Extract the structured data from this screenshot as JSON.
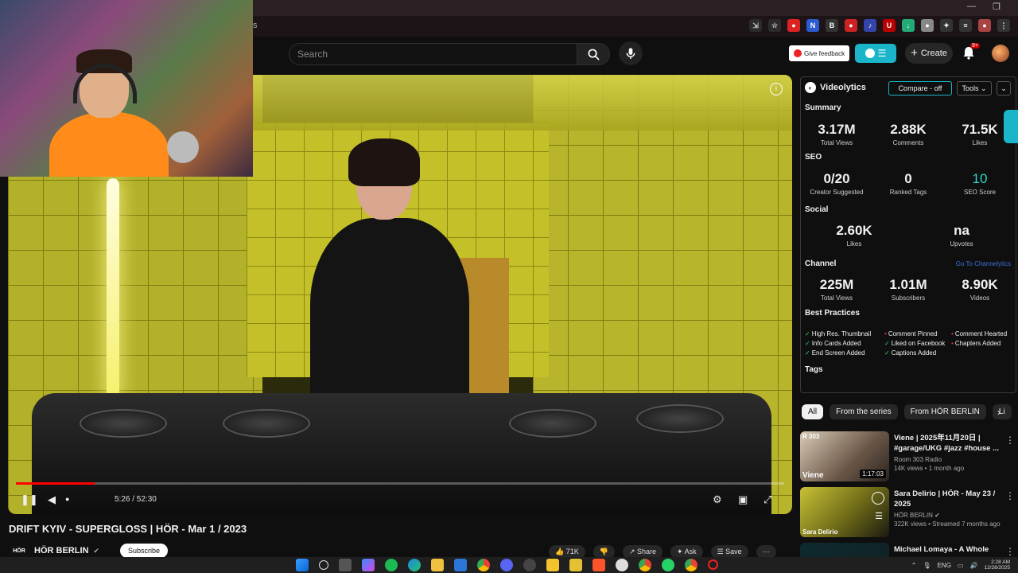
{
  "browser": {
    "url_fragment": "s"
  },
  "header": {
    "search_placeholder": "Search",
    "feedback_label": "Give feedback",
    "create_label": "Create",
    "notifications_badge": "9+"
  },
  "player": {
    "time_display": "5:26 / 52:30",
    "progress_fraction": 0.103
  },
  "video": {
    "title": "DRIFT KYIV - SUPERGLOSS | HÖR - Mar 1 / 2023",
    "channel_name": "HÖR BERLIN",
    "channel_logo_text": "HÖR",
    "subscribe_label": "Subscribe",
    "actions": {
      "likes": "71K",
      "share": "Share",
      "ask": "Ask",
      "save": "Save"
    }
  },
  "videolytics": {
    "brand": "Videolytics",
    "compare_label": "Compare - off",
    "tools_label": "Tools",
    "summary": {
      "heading": "Summary",
      "total_views": {
        "value": "3.17M",
        "label": "Total Views"
      },
      "comments": {
        "value": "2.88K",
        "label": "Comments"
      },
      "likes": {
        "value": "71.5K",
        "label": "Likes"
      }
    },
    "seo": {
      "heading": "SEO",
      "creator_suggested": {
        "value": "0/20",
        "label": "Creator Suggested"
      },
      "ranked_tags": {
        "value": "0",
        "label": "Ranked Tags"
      },
      "seo_score": {
        "value": "10",
        "label": "SEO Score"
      }
    },
    "social": {
      "heading": "Social",
      "likes": {
        "value": "2.60K",
        "label": "Likes"
      },
      "upvotes": {
        "value": "na",
        "label": "Upvotes"
      }
    },
    "channel": {
      "heading": "Channel",
      "goto_link": "Go To Channelytics",
      "total_views": {
        "value": "225M",
        "label": "Total Views"
      },
      "subscribers": {
        "value": "1.01M",
        "label": "Subscribers"
      },
      "videos": {
        "value": "8.90K",
        "label": "Videos"
      }
    },
    "best_practices": {
      "heading": "Best Practices",
      "items": [
        {
          "label": "High Res. Thumbnail",
          "ok": true
        },
        {
          "label": "Comment Pinned",
          "ok": false
        },
        {
          "label": "Comment Hearted",
          "ok": false
        },
        {
          "label": "Info Cards Added",
          "ok": true
        },
        {
          "label": "Liked on Facebook",
          "ok": true
        },
        {
          "label": "Chapters Added",
          "ok": false
        },
        {
          "label": "End Screen Added",
          "ok": true
        },
        {
          "label": "Captions Added",
          "ok": true
        }
      ]
    },
    "tags_heading": "Tags"
  },
  "chips": [
    "All",
    "From the series",
    "From HÖR BERLIN",
    "Li"
  ],
  "related": [
    {
      "title": "Viene | 2025年11月20日 | #garage/UKG #jazz #house ...",
      "channel": "Room 303 Radio",
      "meta": "14K views • 1 month ago",
      "duration": "1:17:03",
      "thumb_label": "Viene",
      "thumb_corner": "R 303"
    },
    {
      "title": "Sara Delirio | HÖR - May 23 / 2025",
      "channel": "HÖR BERLIN",
      "meta": "322K views • Streamed 7 months ago",
      "duration": "",
      "thumb_label": "Sara Delirio",
      "thumb_corner": ""
    },
    {
      "title": "Michael Lomaya - A Whole",
      "channel": "",
      "meta": "",
      "duration": "",
      "thumb_label": "",
      "thumb_corner": ""
    }
  ],
  "taskbar": {
    "lang": "ENG",
    "time": "2:28 AM",
    "date": "12/28/2025"
  },
  "colors": {
    "accent_teal": "#1ab5c8",
    "youtube_red": "#ff0000",
    "good": "#3ecf5a",
    "bad": "#e33333"
  }
}
